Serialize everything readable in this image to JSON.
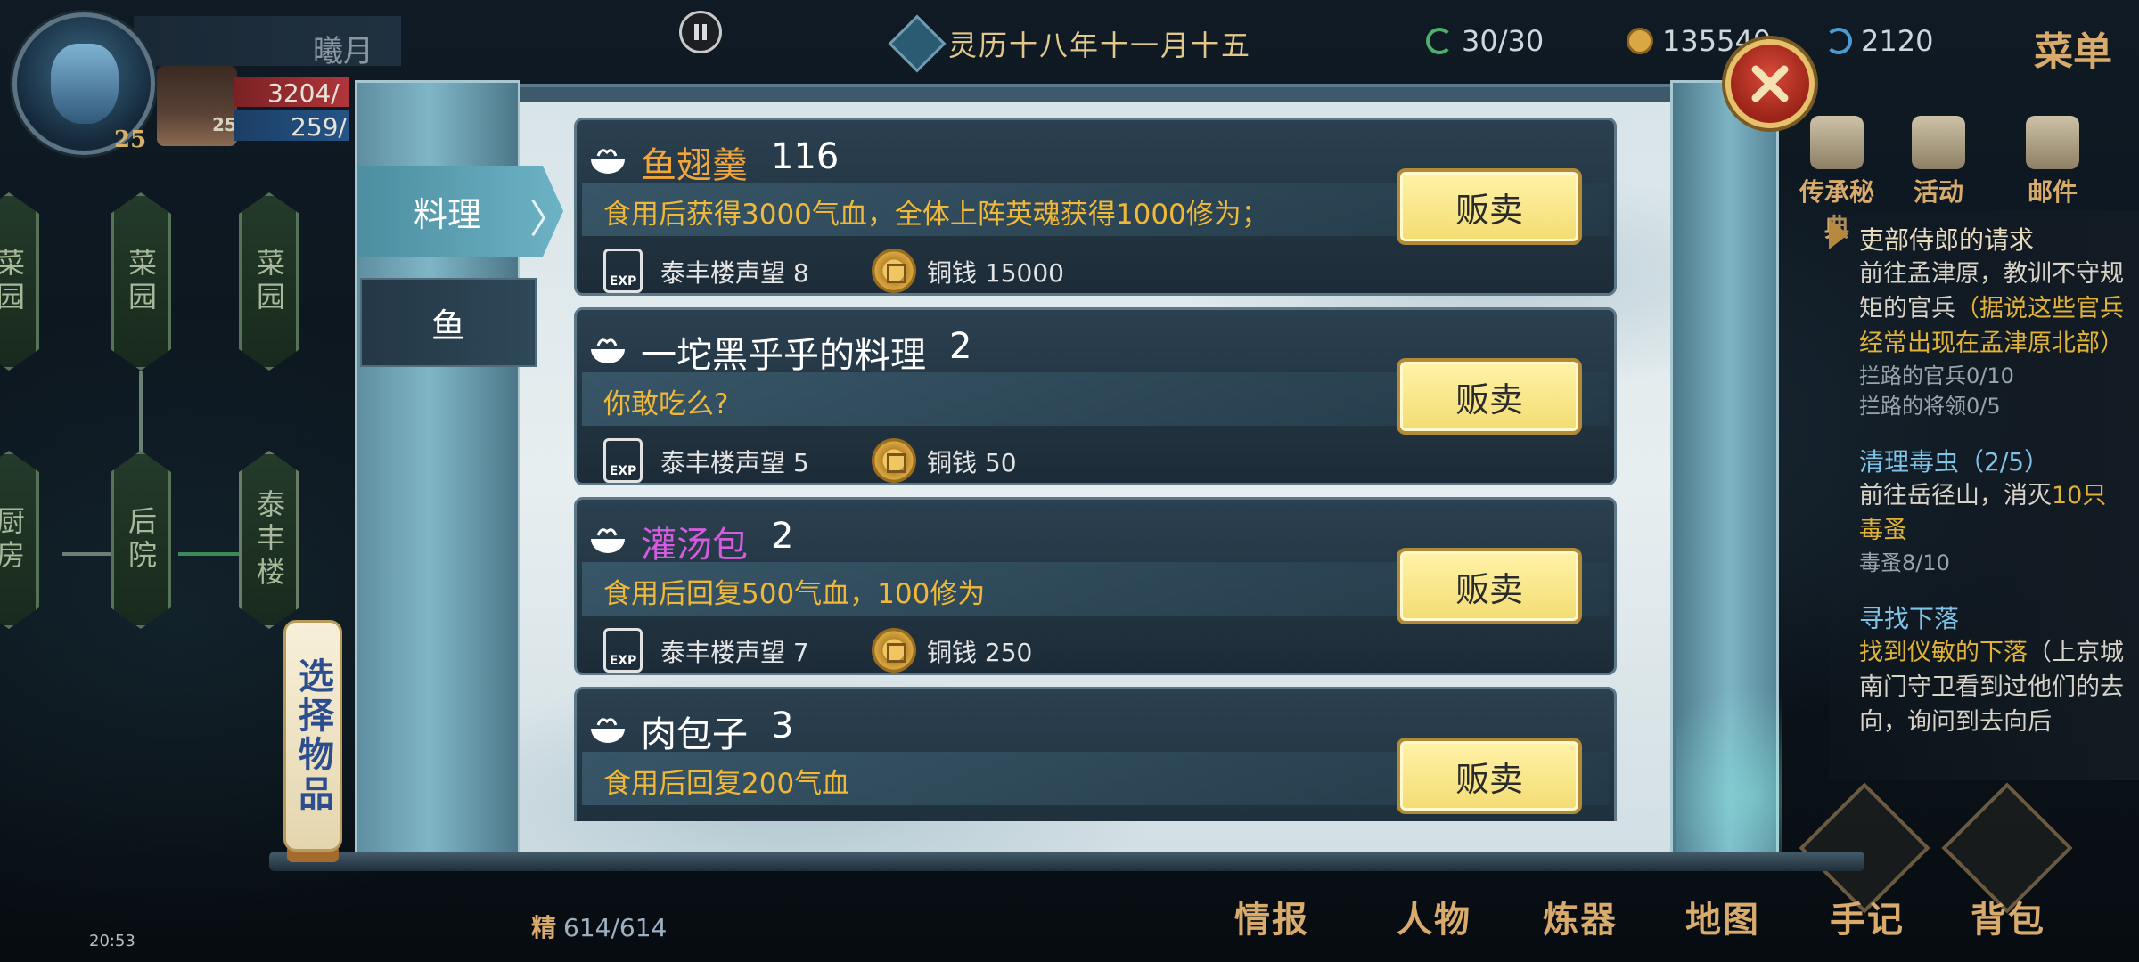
{
  "hud": {
    "player_name": "曦月",
    "player_level": "25",
    "hero_level": "25",
    "hp": "3204/",
    "mp": "259/",
    "date": "灵历十八年十一月十五",
    "stamina": "30/30",
    "coins": "135540",
    "gems": "2120",
    "menu_label": "菜单"
  },
  "features": {
    "secret": "传承秘典",
    "activity": "活动",
    "mail": "邮件"
  },
  "quests": [
    {
      "title": "吏部侍郎的请求",
      "body_plain": "前往孟津原，教训不守规矩的官兵",
      "body_hint": "（据说这些官兵经常出现在孟津原北部）",
      "progress": [
        "拦路的官兵0/10",
        "拦路的将领0/5"
      ]
    },
    {
      "title": "清理毒虫（2/5）",
      "body_plain": "前往岳径山，消灭",
      "body_hint": "10只毒蚤",
      "progress": [
        "毒蚤8/10"
      ]
    },
    {
      "title": "寻找下落",
      "body_hint": "找到仪敏的下落",
      "body_plain": "（上京城南门守卫看到过他们的去向，询问到去向后"
    }
  ],
  "map": {
    "nodes": [
      "菜园",
      "菜园",
      "菜园",
      "厨房",
      "后院",
      "泰丰楼"
    ],
    "select_item": "选择物品"
  },
  "bottom": {
    "spirit_label": "精",
    "spirit_value": "614/614",
    "buttons": [
      "情报",
      "人物",
      "炼器",
      "地图",
      "手记",
      "背包"
    ],
    "status_time": "20:53"
  },
  "shop": {
    "tabs": [
      "料理",
      "鱼"
    ],
    "sell_label": "贩卖",
    "exp_badge": "EXP",
    "items": [
      {
        "name": "鱼翅羹",
        "qty": "116",
        "name_color": "#f2a63a",
        "desc": "食用后获得3000气血，全体上阵英魂获得1000修为；",
        "reputation": "泰丰楼声望 8",
        "price": "铜钱 15000"
      },
      {
        "name": "一坨黑乎乎的料理",
        "qty": "2",
        "name_color": "#ffffff",
        "desc": "你敢吃么?",
        "reputation": "泰丰楼声望 5",
        "price": "铜钱 50"
      },
      {
        "name": "灌汤包",
        "qty": "2",
        "name_color": "#d45ce0",
        "desc": "食用后回复500气血，100修为",
        "reputation": "泰丰楼声望 7",
        "price": "铜钱 250"
      },
      {
        "name": "肉包子",
        "qty": "3",
        "name_color": "#ffffff",
        "desc": "食用后回复200气血",
        "reputation": "",
        "price": ""
      }
    ]
  }
}
